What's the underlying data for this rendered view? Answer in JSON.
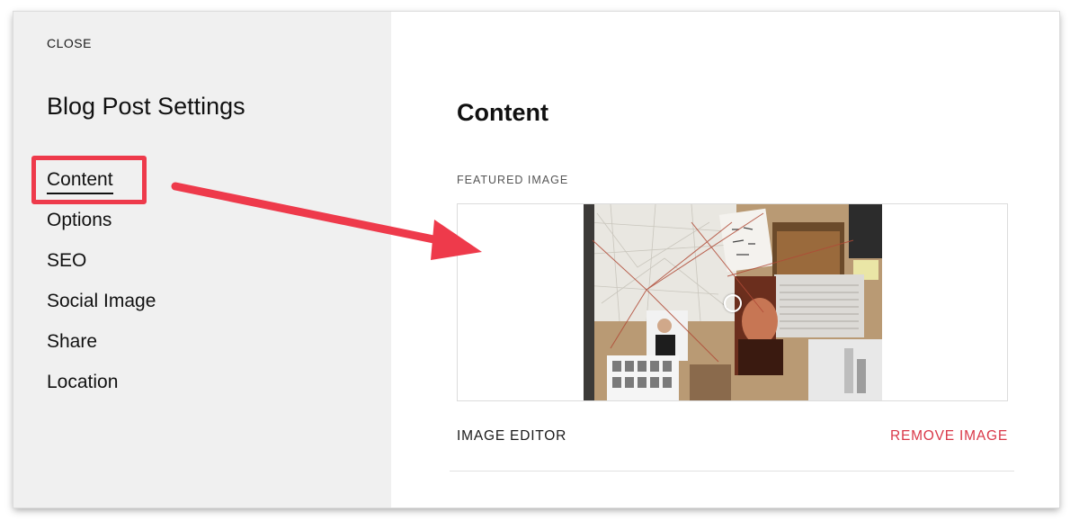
{
  "sidebar": {
    "close_label": "CLOSE",
    "title": "Blog Post Settings",
    "items": [
      {
        "label": "Content"
      },
      {
        "label": "Options"
      },
      {
        "label": "SEO"
      },
      {
        "label": "Social Image"
      },
      {
        "label": "Share"
      },
      {
        "label": "Location"
      }
    ],
    "active_item": "Content"
  },
  "main": {
    "title": "Content",
    "featured_image_label": "FEATURED IMAGE",
    "image_editor_label": "IMAGE EDITOR",
    "remove_image_label": "REMOVE IMAGE"
  },
  "colors": {
    "annotation_red": "#ee3a4b",
    "remove_red": "#d93848",
    "sidebar_bg": "#f0f0f0"
  }
}
